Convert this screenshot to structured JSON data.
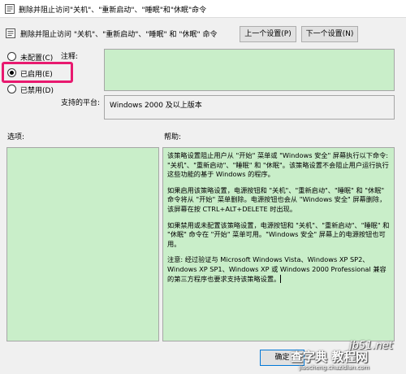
{
  "window": {
    "title": "删除并阻止访问\"关机\"、\"重新启动\"、\"睡眠\"和\"休眠\"命令"
  },
  "header": {
    "setting_name": "删除并阻止访问 \"关机\"、\"重新启动\"、\"睡眠\" 和 \"休眠\" 命令",
    "prev_button": "上一个设置(P)",
    "next_button": "下一个设置(N)"
  },
  "radios": [
    {
      "label": "未配置(C)",
      "checked": false
    },
    {
      "label": "已启用(E)",
      "checked": true
    },
    {
      "label": "已禁用(D)",
      "checked": false
    }
  ],
  "highlight_color": "#e8196f",
  "comment": {
    "label": "注释:",
    "value": ""
  },
  "platform": {
    "label": "支持的平台:",
    "value": "Windows 2000 及以上版本"
  },
  "options": {
    "label": "选项:"
  },
  "help": {
    "label": "帮助:",
    "paragraphs": [
      "该策略设置阻止用户从 \"开始\" 菜单或 \"Windows 安全\" 屏幕执行以下命令: \"关机\"、\"重新启动\"、\"睡眠\" 和 \"休眠\"。该策略设置不会阻止用户运行执行这些功能的基于 Windows 的程序。",
      "如果启用该策略设置，电源按钮和 \"关机\"、\"重新启动\"、\"睡眠\" 和 \"休眠\" 命令将从 \"开始\" 菜单删除。电源按钮也会从 \"Windows 安全\" 屏幕删除，该屏幕在按 CTRL+ALT+DELETE 时出现。",
      "如果禁用或未配置该策略设置，电源按钮和 \"关机\"、\"重新启动\"、\"睡眠\" 和 \"休眠\" 命令在 \"开始\" 菜单可用。\"Windows 安全\" 屏幕上的电源按钮也可用。",
      "注意: 经过验证与 Microsoft Windows Vista、Windows XP SP2、Windows XP SP1、Windows XP 或 Windows 2000 Professional 兼容的第三方程序也要求支持该策略设置。"
    ]
  },
  "footer": {
    "ok_button": "确定"
  },
  "watermark": {
    "line1": "jb51.net",
    "line2": "查字典 教程网",
    "line3": "jiaocheng.chazidian.com"
  }
}
